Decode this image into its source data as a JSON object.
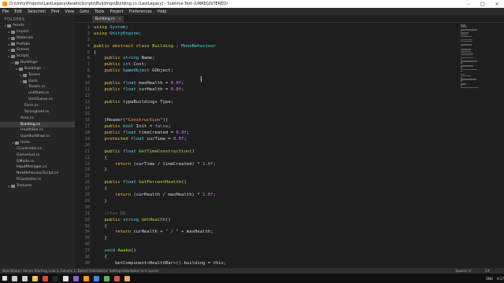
{
  "window": {
    "title": "D:\\Unity\\Projects\\LastLegacy\\Assets\\Scripts\\Buildings\\Building.cs (LastLegacy) - Sublime Text (UNREGISTERED)"
  },
  "menu": [
    "File",
    "Edit",
    "Selection",
    "Find",
    "View",
    "Goto",
    "Tools",
    "Project",
    "Preferences",
    "Help"
  ],
  "sidebar": {
    "title": "FOLDERS",
    "items": [
      {
        "label": "Assets",
        "depth": 0,
        "type": "folder"
      },
      {
        "label": "Import",
        "depth": 1,
        "type": "folder"
      },
      {
        "label": "Materials",
        "depth": 1,
        "type": "folder"
      },
      {
        "label": "Prefabs",
        "depth": 1,
        "type": "folder"
      },
      {
        "label": "Scenes",
        "depth": 1,
        "type": "folder"
      },
      {
        "label": "Scripts",
        "depth": 1,
        "type": "folder"
      },
      {
        "label": "Buildings",
        "depth": 2,
        "type": "folder"
      },
      {
        "label": "Buildings",
        "depth": 3,
        "type": "folder"
      },
      {
        "label": "Tavern",
        "depth": 4,
        "type": "folder"
      },
      {
        "label": "Units",
        "depth": 4,
        "type": "folder"
      },
      {
        "label": "Tavern.cs",
        "depth": 5,
        "type": "file"
      },
      {
        "label": "unitData.cs",
        "depth": 5,
        "type": "file"
      },
      {
        "label": "UnitQueue.cs",
        "depth": 5,
        "type": "file"
      },
      {
        "label": "Farm.cs",
        "depth": 4,
        "type": "file"
      },
      {
        "label": "Stronghold.cs",
        "depth": 4,
        "type": "file"
      },
      {
        "label": "Area.cs",
        "depth": 3,
        "type": "file"
      },
      {
        "label": "Building.cs",
        "depth": 3,
        "type": "file",
        "active": true
      },
      {
        "label": "HealthBar.cs",
        "depth": 3,
        "type": "file"
      },
      {
        "label": "typeBuildings.cs",
        "depth": 3,
        "type": "file"
      },
      {
        "label": "Units",
        "depth": 2,
        "type": "folder"
      },
      {
        "label": "CController.cs",
        "depth": 2,
        "type": "file"
      },
      {
        "label": "GameHud.cs",
        "depth": 2,
        "type": "file"
      },
      {
        "label": "GMode.cs",
        "depth": 2,
        "type": "file"
      },
      {
        "label": "InputManager.cs",
        "depth": 2,
        "type": "file"
      },
      {
        "label": "NewBehaviourScript.cs",
        "depth": 2,
        "type": "file"
      },
      {
        "label": "PController.cs",
        "depth": 2,
        "type": "file"
      },
      {
        "label": "Textures",
        "depth": 1,
        "type": "folder"
      }
    ]
  },
  "tab": {
    "label": "Building.cs",
    "close": "×"
  },
  "editor": {
    "line_numbers": [
      "1",
      "2",
      "3",
      "4",
      "5",
      "6",
      "7",
      "8",
      "9",
      "10",
      "11",
      "12",
      "13",
      "14",
      "15",
      "16",
      "17",
      "18",
      "19",
      "20",
      "21",
      "22",
      "23",
      "24",
      "25",
      "26",
      "27",
      "28",
      "29",
      "30",
      "31",
      "32",
      "33",
      "34",
      "35",
      "36",
      "37",
      "38",
      "39"
    ],
    "lines": [
      [
        [
          "kw",
          "using"
        ],
        [
          "p",
          " "
        ],
        [
          "ty",
          "System"
        ],
        [
          "p",
          ";"
        ]
      ],
      [
        [
          "kw",
          "using"
        ],
        [
          "p",
          " "
        ],
        [
          "ty",
          "UnityEngine"
        ],
        [
          "p",
          ";"
        ]
      ],
      [],
      [
        [
          "kw",
          "public"
        ],
        [
          "p",
          " "
        ],
        [
          "kw",
          "abstract"
        ],
        [
          "p",
          " "
        ],
        [
          "kw",
          "class"
        ],
        [
          "p",
          " "
        ],
        [
          "fn",
          "Building"
        ],
        [
          "p",
          " : "
        ],
        [
          "ty",
          "MonoBehaviour"
        ]
      ],
      [
        [
          "p",
          "{"
        ]
      ],
      [
        [
          "p",
          "    "
        ],
        [
          "kw",
          "public"
        ],
        [
          "p",
          " "
        ],
        [
          "ty",
          "string"
        ],
        [
          "p",
          " Name;"
        ]
      ],
      [
        [
          "p",
          "    "
        ],
        [
          "kw",
          "public"
        ],
        [
          "p",
          " "
        ],
        [
          "ty",
          "int"
        ],
        [
          "p",
          " Cost;"
        ]
      ],
      [
        [
          "p",
          "    "
        ],
        [
          "kw",
          "public"
        ],
        [
          "p",
          " "
        ],
        [
          "ty",
          "GameObject"
        ],
        [
          "p",
          " GObject;"
        ]
      ],
      [],
      [
        [
          "p",
          "    "
        ],
        [
          "kw",
          "public"
        ],
        [
          "p",
          " "
        ],
        [
          "ty",
          "float"
        ],
        [
          "p",
          " maxHealth = "
        ],
        [
          "num",
          "0.0f"
        ],
        [
          "p",
          ";"
        ]
      ],
      [
        [
          "p",
          "    "
        ],
        [
          "kw",
          "public"
        ],
        [
          "p",
          " "
        ],
        [
          "ty",
          "float"
        ],
        [
          "p",
          " curHealth = "
        ],
        [
          "num",
          "0.0f"
        ],
        [
          "p",
          ";"
        ]
      ],
      [],
      [
        [
          "p",
          "    "
        ],
        [
          "kw",
          "public"
        ],
        [
          "p",
          " typeBuildings Type;"
        ]
      ],
      [],
      [],
      [
        [
          "p",
          "    [Header("
        ],
        [
          "str",
          "\"Construction\""
        ],
        [
          "p",
          ")]"
        ]
      ],
      [
        [
          "p",
          "    "
        ],
        [
          "kw",
          "public"
        ],
        [
          "p",
          " "
        ],
        [
          "ty",
          "bool"
        ],
        [
          "p",
          " Init = "
        ],
        [
          "num",
          "false"
        ],
        [
          "p",
          ";"
        ]
      ],
      [
        [
          "p",
          "    "
        ],
        [
          "kw",
          "public"
        ],
        [
          "p",
          " "
        ],
        [
          "ty",
          "float"
        ],
        [
          "p",
          " timeCreated = "
        ],
        [
          "num",
          "0.0f"
        ],
        [
          "p",
          ";"
        ]
      ],
      [
        [
          "p",
          "    "
        ],
        [
          "kw",
          "protected"
        ],
        [
          "p",
          " "
        ],
        [
          "ty",
          "float"
        ],
        [
          "p",
          " curTime = "
        ],
        [
          "num",
          "0.0f"
        ],
        [
          "p",
          ";"
        ]
      ],
      [],
      [
        [
          "p",
          "    "
        ],
        [
          "kw",
          "public"
        ],
        [
          "p",
          " "
        ],
        [
          "ty",
          "float"
        ],
        [
          "p",
          " "
        ],
        [
          "fn",
          "GetTimeConstruction"
        ],
        [
          "p",
          "()"
        ]
      ],
      [
        [
          "p",
          "    {"
        ]
      ],
      [
        [
          "p",
          "        "
        ],
        [
          "kw",
          "return"
        ],
        [
          "p",
          " (curTime / timeCreated) * "
        ],
        [
          "num",
          "1.0f"
        ],
        [
          "p",
          ";"
        ]
      ],
      [
        [
          "p",
          "    }"
        ]
      ],
      [],
      [
        [
          "p",
          "    "
        ],
        [
          "kw",
          "public"
        ],
        [
          "p",
          " "
        ],
        [
          "ty",
          "float"
        ],
        [
          "p",
          " "
        ],
        [
          "fn",
          "GetPercentHealth"
        ],
        [
          "p",
          "()"
        ]
      ],
      [
        [
          "p",
          "    {"
        ]
      ],
      [
        [
          "p",
          "        "
        ],
        [
          "kw",
          "return"
        ],
        [
          "p",
          " (curHealth / maxHealth) * "
        ],
        [
          "num",
          "1.0f"
        ],
        [
          "p",
          ";"
        ]
      ],
      [
        [
          "p",
          "    }"
        ]
      ],
      [],
      [
        [
          "p",
          "    "
        ],
        [
          "cm",
          "//for UI"
        ]
      ],
      [
        [
          "p",
          "    "
        ],
        [
          "kw",
          "public"
        ],
        [
          "p",
          " "
        ],
        [
          "ty",
          "string"
        ],
        [
          "p",
          " "
        ],
        [
          "fn",
          "GetHealth"
        ],
        [
          "p",
          "()"
        ]
      ],
      [
        [
          "p",
          "    {"
        ]
      ],
      [
        [
          "p",
          "        "
        ],
        [
          "kw",
          "return"
        ],
        [
          "p",
          " curHealth + "
        ],
        [
          "str",
          "\" / \""
        ],
        [
          "p",
          " + maxHealth;"
        ]
      ],
      [
        [
          "p",
          "    }"
        ]
      ],
      [],
      [
        [
          "p",
          "    "
        ],
        [
          "ty",
          "void"
        ],
        [
          "p",
          " "
        ],
        [
          "fn",
          "Awake"
        ],
        [
          "p",
          "()"
        ]
      ],
      [
        [
          "p",
          "    {"
        ]
      ],
      [
        [
          "p",
          "        GetComponent<HealthBar>().building = this;"
        ]
      ]
    ]
  },
  "status": {
    "left": "OmniSharp : Server Starting, Line 1, Column 1; Detect Indentation: Setting indentation to 4 spaces",
    "spaces": "Spaces: 4",
    "syntax": "C#"
  },
  "taskbar": {
    "icons": [
      {
        "name": "search-icon",
        "color": "#cccccc"
      },
      {
        "name": "task-view-icon",
        "color": "#cccccc"
      },
      {
        "name": "explorer-icon",
        "color": "#f4c542"
      },
      {
        "name": "chrome-icon",
        "color": "#e94235"
      },
      {
        "name": "steam-icon",
        "color": "#1b2838"
      },
      {
        "name": "unity-icon",
        "color": "#e0e0e0"
      },
      {
        "name": "visual-studio-icon",
        "color": "#8e5cd9"
      },
      {
        "name": "sublime-icon",
        "color": "#ff9800"
      },
      {
        "name": "app-icon",
        "color": "#3a8ee6"
      },
      {
        "name": "app-icon",
        "color": "#5cb85c"
      },
      {
        "name": "app-icon",
        "color": "#d9534f"
      },
      {
        "name": "app-icon",
        "color": "#f0ad4e"
      }
    ],
    "lang": "ENG",
    "time": "4:17"
  }
}
